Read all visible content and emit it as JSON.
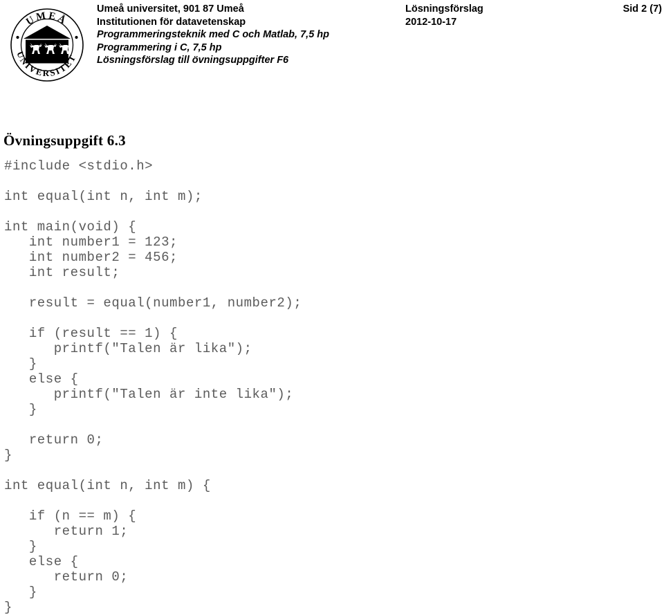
{
  "header": {
    "logo": {
      "icon": "umea-university-seal-logo",
      "top_text": "UMEÅ",
      "bottom_text": "UNIVERSITET"
    },
    "organization_lines": [
      {
        "text": "Umeå universitet, 901 87 Umeå",
        "italic": false
      },
      {
        "text": "Institutionen för datavetenskap",
        "italic": false
      },
      {
        "text": "Programmeringsteknik med C och Matlab, 7,5 hp",
        "italic": true
      },
      {
        "text": "Programmering i C, 7,5 hp",
        "italic": true
      },
      {
        "text": "Lösningsförslag till övningsuppgifter F6",
        "italic": true
      }
    ],
    "document_type": "Lösningsförslag",
    "document_date": "2012-10-17",
    "page_indicator": "Sid 2 (7)"
  },
  "main": {
    "exercise_title": "Övningsuppgift 6.3",
    "code": "#include <stdio.h>\n\nint equal(int n, int m);\n\nint main(void) {\n   int number1 = 123;\n   int number2 = 456;\n   int result;\n\n   result = equal(number1, number2);\n\n   if (result == 1) {\n      printf(\"Talen är lika\");\n   }\n   else {\n      printf(\"Talen är inte lika\");\n   }\n\n   return 0;\n}\n\nint equal(int n, int m) {\n\n   if (n == m) {\n      return 1;\n   }\n   else {\n      return 0;\n   }\n}",
    "code_color": "#5b5b5b"
  }
}
